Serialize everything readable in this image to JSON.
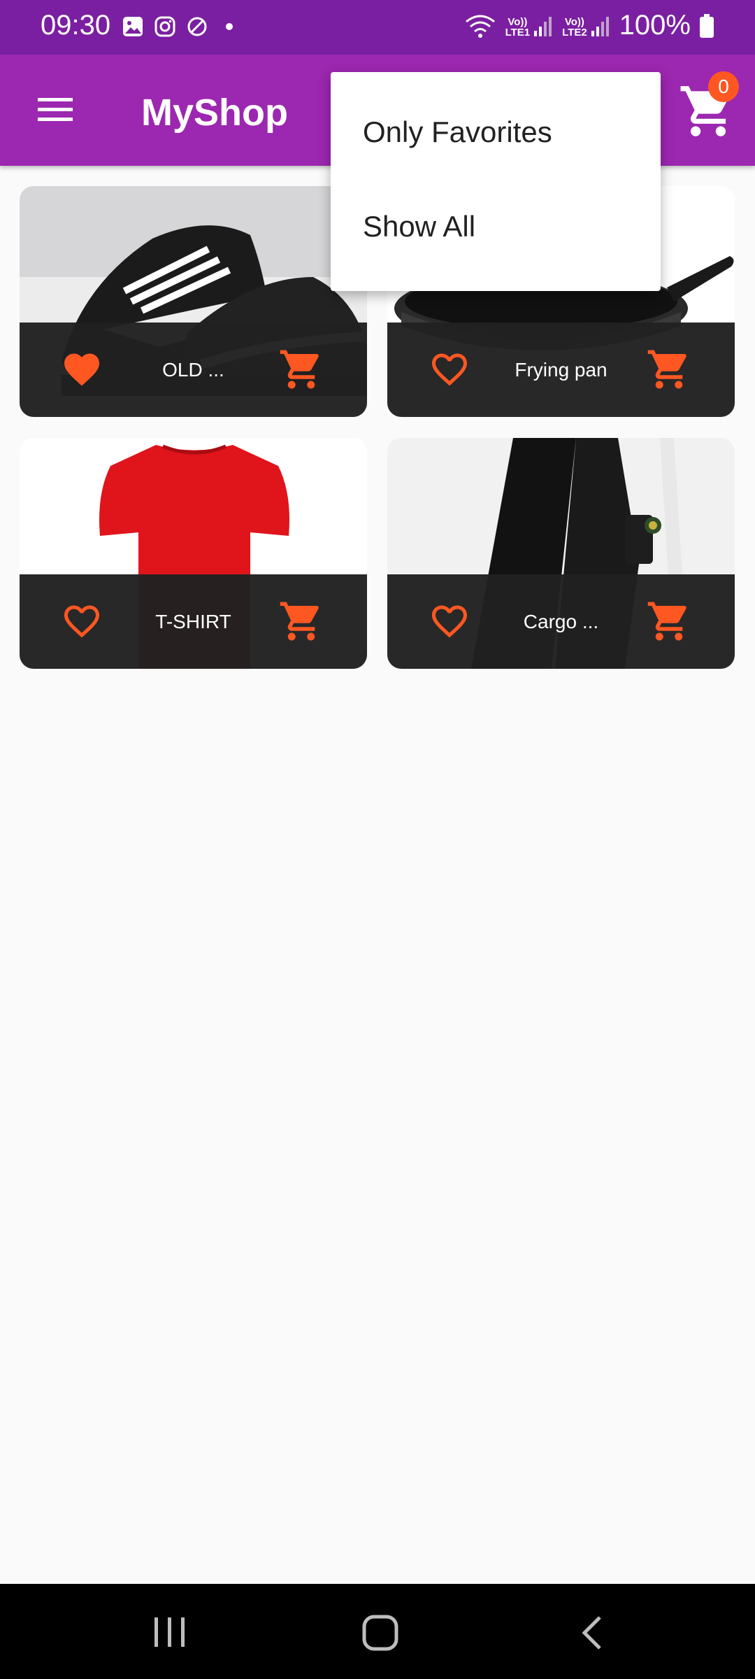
{
  "status_bar": {
    "time": "09:30",
    "sim1_label": "LTE1",
    "sim2_label": "LTE2",
    "volte": "Vo))",
    "battery": "100%"
  },
  "app_bar": {
    "title": "MyShop",
    "cart_count": "0"
  },
  "popup_menu": {
    "items": [
      {
        "label": "Only Favorites"
      },
      {
        "label": "Show All"
      }
    ]
  },
  "products": [
    {
      "title": "OLD ...",
      "favorite": true
    },
    {
      "title": "Frying pan",
      "favorite": false
    },
    {
      "title": "T-SHIRT",
      "favorite": false
    },
    {
      "title": "Cargo ...",
      "favorite": false
    }
  ],
  "colors": {
    "status_bar": "#7b1fa2",
    "app_bar": "#9c27b0",
    "accent": "#ff5722",
    "footer": "#212121"
  },
  "icons": {
    "menu": "menu-icon",
    "cart": "shopping-cart-icon",
    "favorite": "heart-icon"
  }
}
